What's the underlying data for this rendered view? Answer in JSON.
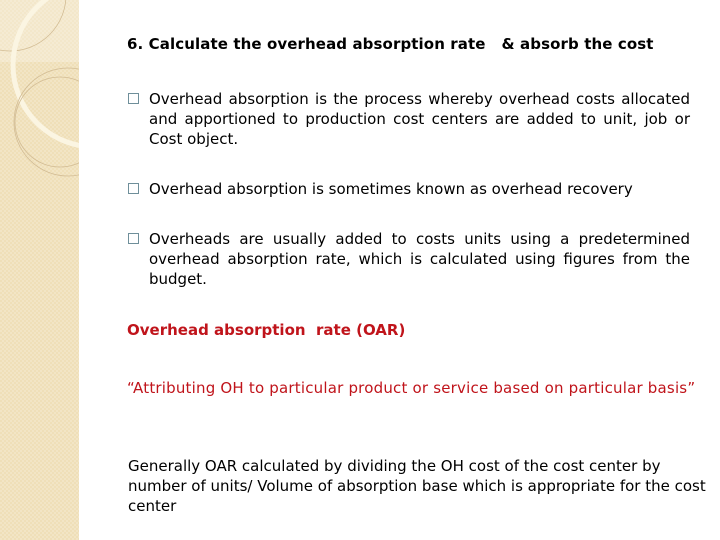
{
  "slide": {
    "title": "6. Calculate the overhead absorption rate   & absorb the cost",
    "bullets": [
      {
        "icon": "square-bullet-icon",
        "text": "Overhead absorption is the process whereby overhead costs allocated and apportioned to production cost centers are added to unit, job or Cost object."
      },
      {
        "icon": "square-bullet-icon",
        "text": "Overhead absorption is sometimes known as overhead recovery"
      },
      {
        "icon": "square-bullet-icon",
        "text": "Overheads are usually added to costs units using a predetermined overhead absorption rate, which is calculated using figures from the budget."
      }
    ],
    "oar_heading": "Overhead absorption  rate (OAR)",
    "oar_quote": "“Attributing OH to particular product or service based on particular basis”",
    "oar_note": "Generally OAR calculated by dividing the OH cost of the cost center by number of units/ Volume of absorption base which is appropriate for the cost center"
  },
  "colors": {
    "accent_red": "#c0141b",
    "sidebar_beige": "#efdfb8",
    "bullet_border": "#6f8f9a"
  }
}
